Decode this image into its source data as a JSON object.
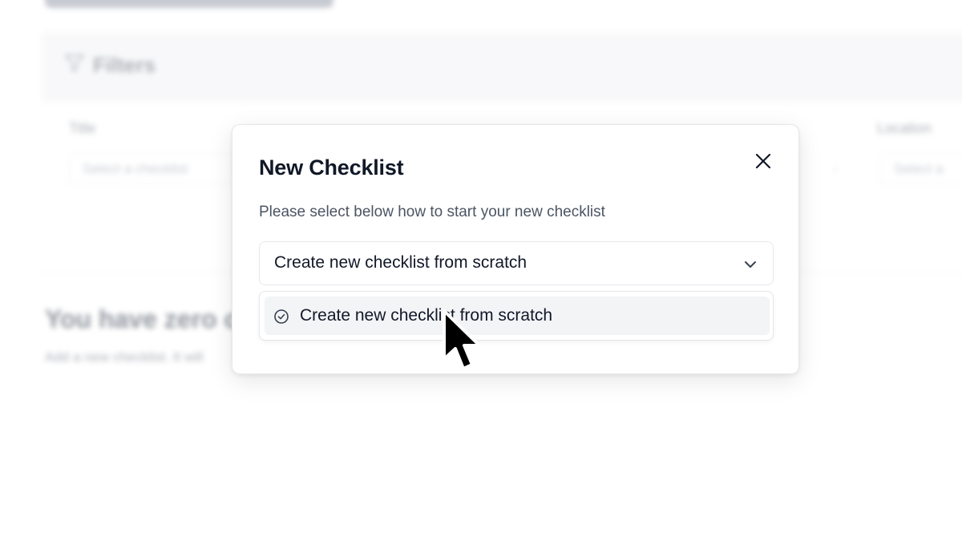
{
  "background": {
    "filters_label": "Filters",
    "title_label": "Title",
    "title_select_placeholder": "Select a checklist",
    "location_label": "Location",
    "location_select_placeholder": "Select a",
    "empty_heading": "You have zero c",
    "empty_subtext": "Add a new checklist. It will"
  },
  "modal": {
    "title": "New Checklist",
    "description": "Please select below how to start your new checklist",
    "select": {
      "value": "Create new checklist from scratch"
    },
    "dropdown": {
      "options": [
        {
          "label": "Create new checklist from scratch",
          "selected": true
        }
      ]
    }
  },
  "icons": {
    "close": "close-icon",
    "chevron": "chevron-down-icon",
    "check": "check-circle-icon",
    "filter": "filter-icon",
    "cursor": "mouse-pointer-icon"
  },
  "colors": {
    "text_primary": "#111827",
    "text_secondary": "#4b5563",
    "border": "#e5e7eb",
    "option_hover": "#f3f4f6",
    "primary_button": "#111827"
  }
}
